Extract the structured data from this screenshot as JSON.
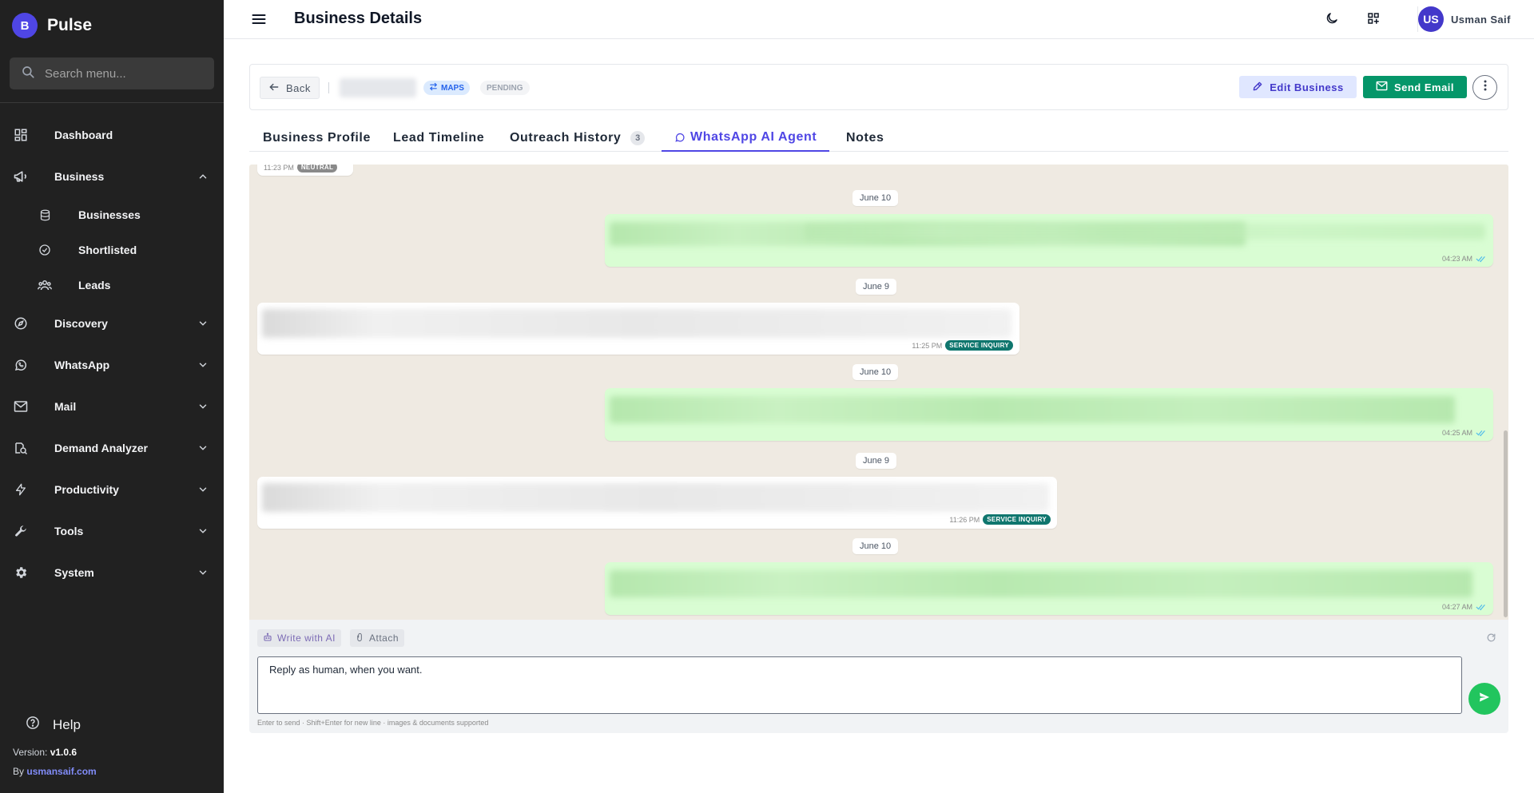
{
  "app": {
    "badge": "B",
    "name": "Pulse"
  },
  "sidebar": {
    "search_placeholder": "Search menu...",
    "items": [
      {
        "label": "Dashboard"
      },
      {
        "label": "Business"
      },
      {
        "label": "Businesses"
      },
      {
        "label": "Shortlisted"
      },
      {
        "label": "Leads"
      },
      {
        "label": "Discovery"
      },
      {
        "label": "WhatsApp"
      },
      {
        "label": "Mail"
      },
      {
        "label": "Demand Analyzer"
      },
      {
        "label": "Productivity"
      },
      {
        "label": "Tools"
      },
      {
        "label": "System"
      }
    ],
    "help": "Help",
    "version_label": "Version:",
    "version": "v1.0.6",
    "by_label": "By",
    "author_link": "usmansaif.com"
  },
  "topbar": {
    "title": "Business Details",
    "user_initials": "US",
    "user_name": "Usman Saif"
  },
  "header": {
    "back": "Back",
    "source_badge": "MAPS",
    "status_badge": "PENDING",
    "edit": "Edit Business",
    "email": "Send Email"
  },
  "tabs": [
    {
      "label": "Business Profile"
    },
    {
      "label": "Lead Timeline"
    },
    {
      "label": "Outreach History",
      "count": "3"
    },
    {
      "label": "WhatsApp AI Agent",
      "active": true
    },
    {
      "label": "Notes"
    }
  ],
  "chat": {
    "top_meta": {
      "time": "11:23 PM",
      "tag": "NEUTRAL"
    },
    "messages": [
      {
        "date": "June 10",
        "dir": "out",
        "time": "04:23 AM"
      },
      {
        "date": "June 9",
        "dir": "in",
        "time": "11:25 PM",
        "tag": "SERVICE INQUIRY"
      },
      {
        "date": "June 10",
        "dir": "out",
        "time": "04:25 AM"
      },
      {
        "date": "June 9",
        "dir": "in",
        "time": "11:26 PM",
        "tag": "SERVICE INQUIRY"
      },
      {
        "date": "June 10",
        "dir": "out",
        "time": "04:27 AM"
      }
    ]
  },
  "composer": {
    "write_ai": "Write with AI",
    "attach": "Attach",
    "placeholder": "Reply as human, when you want.",
    "hint": "Enter to send · Shift+Enter for new line · images & documents supported"
  },
  "colors": {
    "sidebar_bg": "#212121",
    "accent": "#4f46e5",
    "send_email": "#059669",
    "chat_bg": "#efeae2",
    "outgoing_bubble": "#d9fdd3",
    "tag_teal": "#0f766e"
  }
}
